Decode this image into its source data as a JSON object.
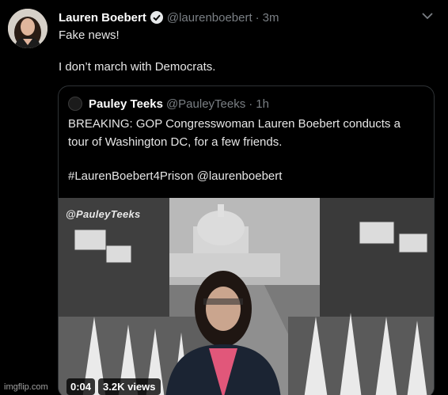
{
  "tweet": {
    "name": "Lauren Boebert",
    "handle": "@laurenboebert",
    "time_sep": "·",
    "time": "3m",
    "lines": [
      "Fake news!",
      "I don’t march with Democrats."
    ]
  },
  "quote": {
    "name": "Pauley Teeks",
    "handle": "@PauleyTeeks",
    "time_sep": "·",
    "time": "1h",
    "line1": "BREAKING: GOP Congresswoman Lauren Boebert conducts a",
    "line2": "tour of Washington DC, for a few friends.",
    "line3": "#LaurenBoebert4Prison @laurenboebert"
  },
  "media": {
    "watermark": "@PauleyTeeks",
    "duration": "0:04",
    "views": "3.2K views"
  },
  "footer": {
    "credit": "imgflip.com"
  },
  "icons": {
    "verified": "verified-badge-icon",
    "more": "chevron-down-icon"
  },
  "colors": {
    "background": "#000000",
    "border": "#2f3336",
    "muted": "#7a7f84",
    "verified": "#1d9bf0"
  }
}
